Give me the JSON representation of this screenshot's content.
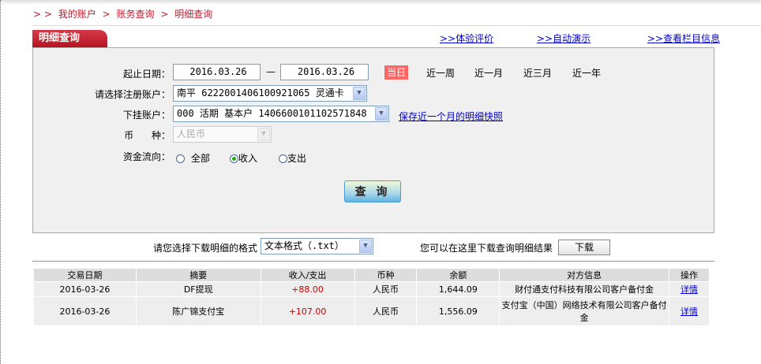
{
  "breadcrumb": {
    "prefix": "> >",
    "items": [
      "我的账户",
      "账务查询",
      "明细查询"
    ],
    "sep": ">"
  },
  "tab_title": "明细查询",
  "top_links": [
    {
      "label": ">>体验评价"
    },
    {
      "label": ">>自动演示"
    },
    {
      "label": ">>查看栏目信息"
    }
  ],
  "form": {
    "date_label": "起止日期：",
    "date_from": "2016.03.26",
    "date_sep": "—",
    "date_to": "2016.03.26",
    "quick_ranges": [
      "当日",
      "近一周",
      "近一月",
      "近三月",
      "近一年"
    ],
    "account_label": "请选择注册账户：",
    "account_value": "南平  6222001406100921065 灵通卡",
    "sub_label": "下挂账户：",
    "sub_value": "000 活期 基本户 1406600101102571848",
    "snapshot_link": "保存近一个月的明细快照",
    "currency_label": "币      种：",
    "currency_value": "人民币",
    "flow_label": "资金流向：",
    "flow_options": [
      "全部",
      "收入",
      "支出"
    ],
    "flow_selected": "收入",
    "query_button": "查 询"
  },
  "download": {
    "label": "请您选择下载明细的格式",
    "format": "文本格式（.txt）",
    "hint": "您可以在这里下载查询明细结果",
    "button": "下载"
  },
  "table": {
    "headers": [
      "交易日期",
      "摘要",
      "收入/支出",
      "币种",
      "余额",
      "对方信息",
      "操作"
    ],
    "rows": [
      [
        "2016-03-26",
        "DF提现",
        "+88.00",
        "人民币",
        "1,644.09",
        "财付通支付科技有限公司客户备付金",
        "详情"
      ],
      [
        "2016-03-26",
        "陈广锦支付宝",
        "+107.00",
        "人民币",
        "1,556.09",
        "支付宝（中国）网络技术有限公司客户备付金",
        "详情"
      ]
    ]
  },
  "colors": {
    "brand_red": "#c0182b",
    "today_bg": "#ff6666",
    "link": "#0000cc"
  }
}
